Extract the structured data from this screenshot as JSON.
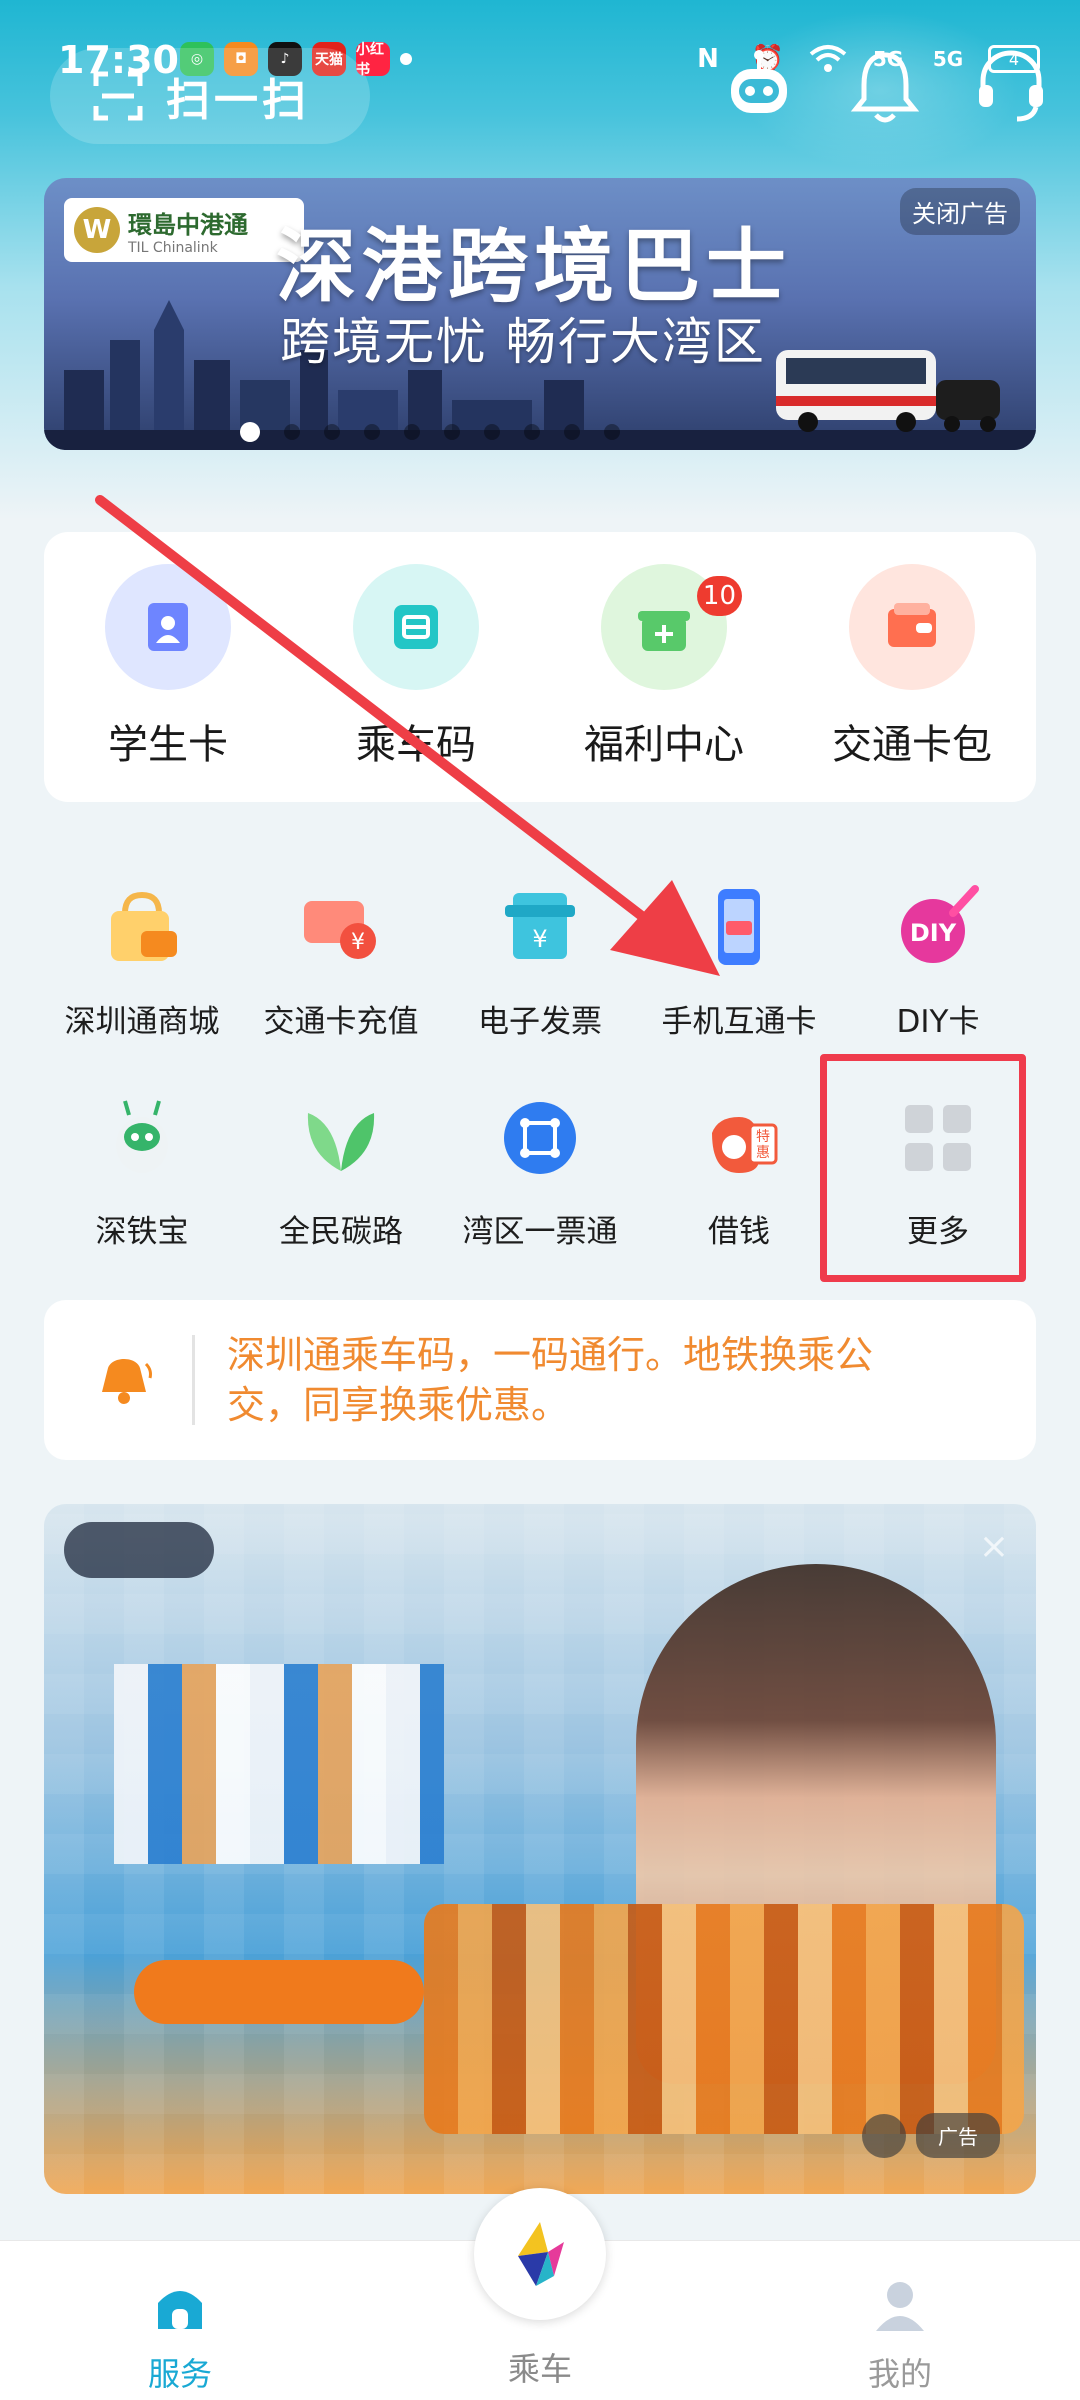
{
  "status_bar": {
    "time": "17:30",
    "apps": [
      {
        "icon": "wechat-icon",
        "color": "#2ec15b",
        "glyph": "◎"
      },
      {
        "icon": "taobao-icon",
        "color": "#f58a1f",
        "glyph": "◘"
      },
      {
        "icon": "tiktok-icon",
        "color": "#111111",
        "glyph": "♪"
      },
      {
        "icon": "tmall-icon",
        "color": "#e2231a",
        "glyph": "天猫"
      },
      {
        "icon": "xiaohongshu-icon",
        "color": "#ff2442",
        "glyph": "小红书"
      }
    ],
    "network": "5G",
    "battery": "4"
  },
  "header": {
    "scan_label": "扫一扫",
    "icons": [
      "robot-assistant-icon",
      "bell-icon",
      "headset-icon"
    ]
  },
  "banner": {
    "logo_text": "環島中港通",
    "logo_sub": "TIL Chinalink",
    "title": "深港跨境巴士",
    "subtitle": "跨境无忧 畅行大湾区",
    "close_label": "关闭广告",
    "dot_count": 10,
    "active_dot": 0
  },
  "primary_items": [
    {
      "label": "学生卡",
      "icon": "student-card-icon",
      "bg": "#dfe6ff",
      "fg": "#6e85ff"
    },
    {
      "label": "乘车码",
      "icon": "ride-code-icon",
      "bg": "#d7f6f4",
      "fg": "#23c6c6"
    },
    {
      "label": "福利中心",
      "icon": "welfare-gift-icon",
      "bg": "#dff6dd",
      "fg": "#58c96a",
      "badge": "10"
    },
    {
      "label": "交通卡包",
      "icon": "card-wallet-icon",
      "bg": "#ffe5de",
      "fg": "#ff6f50"
    }
  ],
  "grid_rows": [
    [
      {
        "label": "深圳通商城",
        "icon": "shopping-bag-icon"
      },
      {
        "label": "交通卡充值",
        "icon": "card-recharge-icon"
      },
      {
        "label": "电子发票",
        "icon": "e-invoice-icon"
      },
      {
        "label": "手机互通卡",
        "icon": "phone-card-icon"
      },
      {
        "label": "DIY卡",
        "icon": "diy-card-icon"
      }
    ],
    [
      {
        "label": "深铁宝",
        "icon": "mascot-icon"
      },
      {
        "label": "全民碳路",
        "icon": "leaf-icon"
      },
      {
        "label": "湾区一票通",
        "icon": "bay-area-ticket-icon"
      },
      {
        "label": "借钱",
        "icon": "money-bag-icon"
      },
      {
        "label": "更多",
        "icon": "more-grid-icon"
      }
    ]
  ],
  "notice": {
    "text": "深圳通乘车码，一码通行。地铁换乘公交，同享换乘优惠。"
  },
  "ad": {
    "close_glyph": "×",
    "label": "广告"
  },
  "bottom_nav": {
    "items": [
      {
        "label": "服务",
        "icon": "service-home-icon",
        "active": true
      },
      {
        "label": "乘车",
        "icon": "ride-logo-icon",
        "active": false
      },
      {
        "label": "我的",
        "icon": "profile-icon",
        "active": false
      }
    ]
  },
  "colors": {
    "accent": "#19a9d4",
    "highlight_box": "#ef3b4c",
    "notice_text": "#f08a30",
    "badge": "#ee3b2f"
  }
}
